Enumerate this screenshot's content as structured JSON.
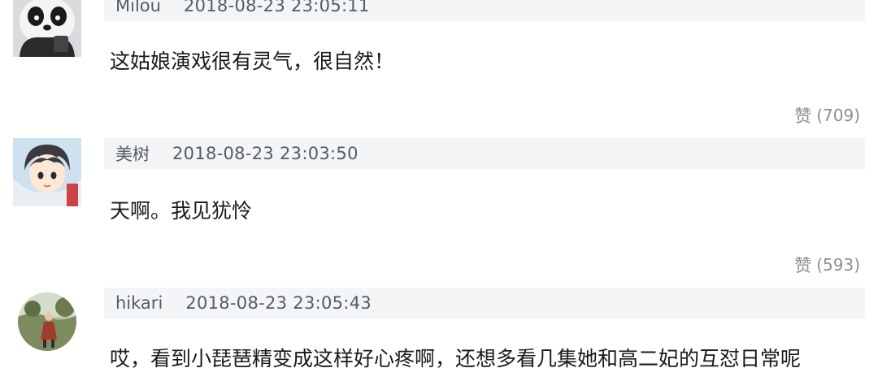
{
  "comments": [
    {
      "username": "Milou",
      "timestamp": "2018-08-23 23:05:11",
      "text": "这姑娘演戏很有灵气，很自然！",
      "like_icon": "赞",
      "likes": "(709)"
    },
    {
      "username": "美树",
      "timestamp": "2018-08-23 23:03:50",
      "text": "天啊。我见犹怜",
      "like_icon": "赞",
      "likes": "(593)"
    },
    {
      "username": "hikari",
      "timestamp": "2018-08-23 23:05:43",
      "text": "哎，看到小琵琶精变成这样好心疼啊，还想多看几集她和高二妃的互怼日常呢"
    }
  ],
  "icons": {
    "like": "thumbs-up-icon",
    "avatar_1": "panda-avatar-icon",
    "avatar_2": "anime-girl-avatar-icon",
    "avatar_3": "photo-avatar-icon"
  }
}
